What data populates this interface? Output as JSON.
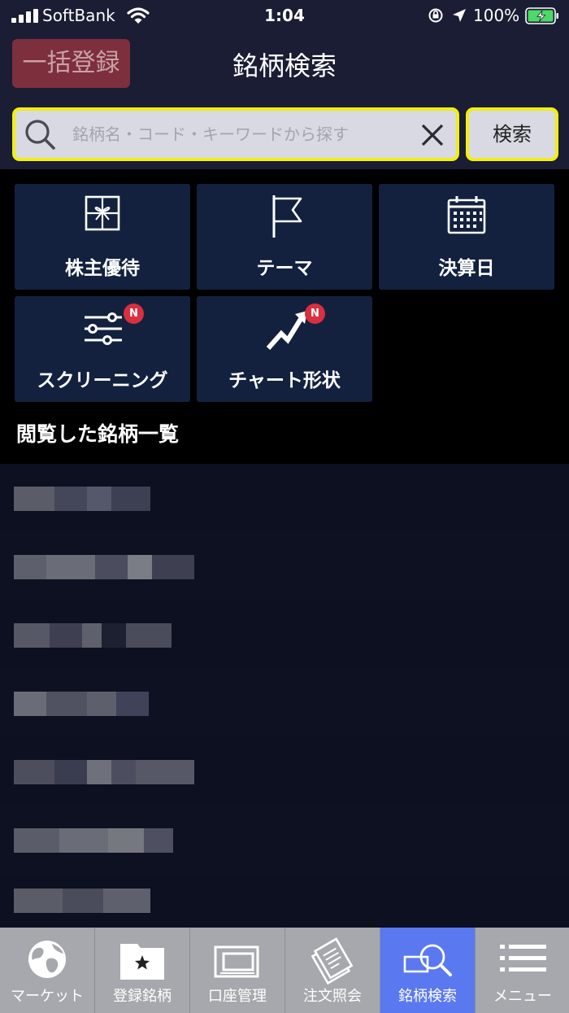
{
  "status_bar": {
    "carrier": "SoftBank",
    "time": "1:04",
    "battery_percent": "100%"
  },
  "header": {
    "bulk_register_label": "一括登録",
    "title": "銘柄検索"
  },
  "search": {
    "placeholder": "銘柄名・コード・キーワードから探す",
    "value": "",
    "button_label": "検索"
  },
  "tiles": [
    {
      "label": "株主優待",
      "icon": "gift-icon",
      "badge": ""
    },
    {
      "label": "テーマ",
      "icon": "flag-icon",
      "badge": ""
    },
    {
      "label": "決算日",
      "icon": "calendar-icon",
      "badge": ""
    },
    {
      "label": "スクリーニング",
      "icon": "sliders-icon",
      "badge": "N"
    },
    {
      "label": "チャート形状",
      "icon": "chart-trend-icon",
      "badge": "N"
    }
  ],
  "history": {
    "title": "閲覧した銘柄一覧",
    "items_redacted": 7
  },
  "tab_bar": {
    "active_index": 4,
    "tabs": [
      {
        "label": "マーケット",
        "icon": "globe-icon"
      },
      {
        "label": "登録銘柄",
        "icon": "star-folder-icon"
      },
      {
        "label": "口座管理",
        "icon": "account-icon"
      },
      {
        "label": "注文照会",
        "icon": "documents-icon"
      },
      {
        "label": "銘柄検索",
        "icon": "search-card-icon"
      },
      {
        "label": "メニュー",
        "icon": "menu-icon"
      }
    ]
  },
  "colors": {
    "header_bg": "#1a1d33",
    "tile_bg": "#13213f",
    "highlight": "#f2ee12",
    "badge": "#d8303e",
    "active_tab": "#5a78f0",
    "bulk_button": "#7d2f3d"
  }
}
